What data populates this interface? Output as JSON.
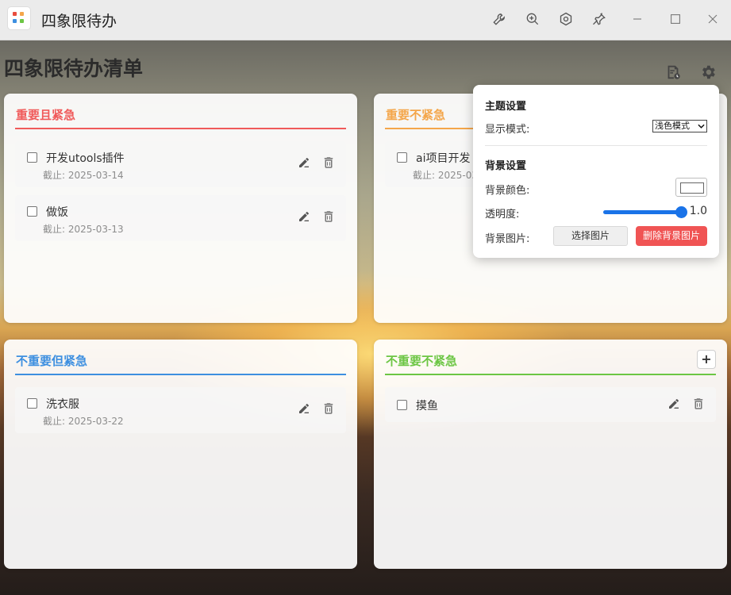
{
  "window": {
    "title": "四象限待办",
    "toolbar_icons": [
      "wrench-icon",
      "zoom-in-icon",
      "hexagon-settings-icon",
      "pin-icon",
      "minimize-icon",
      "maximize-icon",
      "close-icon"
    ]
  },
  "page": {
    "heading": "四象限待办清单"
  },
  "colors": {
    "urgent_important": "#f05a5a",
    "important_not_urgent": "#f4a64a",
    "urgent_not_important": "#3d8fe0",
    "neither": "#6cc644",
    "delete_button": "#f05454",
    "slider": "#1a73e8"
  },
  "quadrants": [
    {
      "title": "重要且紧急",
      "tasks": [
        {
          "title": "开发utools插件",
          "due": "截止: 2025-03-14"
        },
        {
          "title": "做饭",
          "due": "截止: 2025-03-13"
        }
      ]
    },
    {
      "title": "重要不紧急",
      "tasks": [
        {
          "title": "ai项目开发",
          "due": "截止: 2025-03"
        }
      ]
    },
    {
      "title": "不重要但紧急",
      "tasks": [
        {
          "title": "洗衣服",
          "due": "截止: 2025-03-22"
        }
      ]
    },
    {
      "title": "不重要不紧急",
      "add_label": "+",
      "tasks": [
        {
          "title": "摸鱼"
        }
      ]
    }
  ],
  "settings": {
    "theme_heading": "主题设置",
    "display_mode_label": "显示模式:",
    "display_mode_value": "浅色模式",
    "background_heading": "背景设置",
    "bg_color_label": "背景颜色:",
    "opacity_label": "透明度:",
    "opacity_value": "1.0",
    "bg_image_label": "背景图片:",
    "choose_image": "选择图片",
    "delete_image": "删除背景图片"
  }
}
